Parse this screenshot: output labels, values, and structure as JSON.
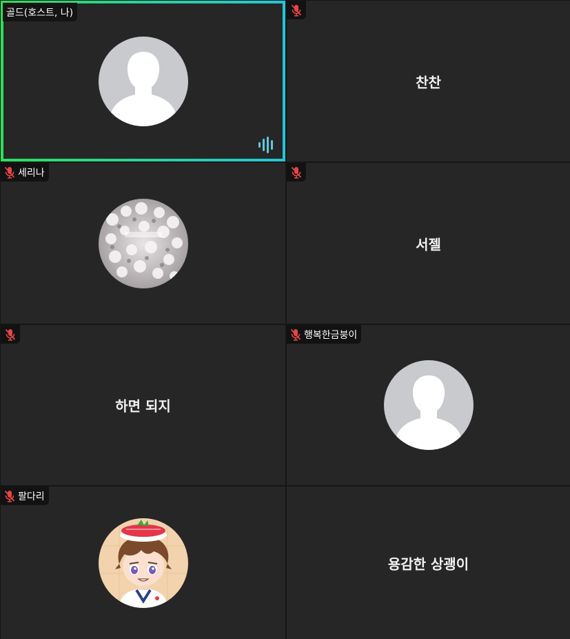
{
  "participants": [
    {
      "name": "골드(호스트, 나)",
      "muted": false,
      "has_avatar": true,
      "avatar_kind": "default-person",
      "speaking": true
    },
    {
      "name": "찬찬",
      "muted": true,
      "has_avatar": false
    },
    {
      "name": "세리나",
      "muted": true,
      "has_avatar": true,
      "avatar_kind": "cherry-blossom-photo"
    },
    {
      "name": "서젤",
      "muted": true,
      "has_avatar": false
    },
    {
      "name": "하면 되지",
      "muted": true,
      "has_avatar": false
    },
    {
      "name": "행복한금붕이",
      "muted": true,
      "has_avatar": true,
      "avatar_kind": "default-person"
    },
    {
      "name": "팔다리",
      "muted": true,
      "has_avatar": true,
      "avatar_kind": "cartoon-sushi-boy"
    },
    {
      "name": "용감한 상괭이",
      "muted": true,
      "has_avatar": false
    }
  ],
  "icons": {
    "muted_mic": "mic-muted-icon",
    "speaking": "audio-level-icon"
  },
  "colors": {
    "tile_background": "#262626",
    "active_speaker_border_start": "#2ee05c",
    "active_speaker_border_end": "#23c6d9",
    "muted_mic": "#e64545",
    "audio_level": "#5fc8dc"
  }
}
